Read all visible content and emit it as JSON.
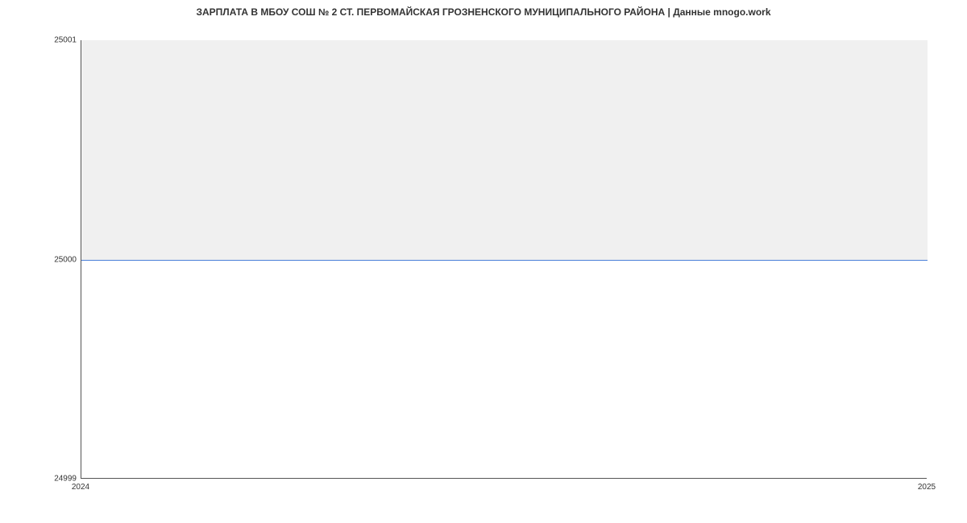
{
  "chart_data": {
    "type": "line",
    "title": "ЗАРПЛАТА В МБОУ СОШ № 2  СТ. ПЕРВОМАЙСКАЯ ГРОЗНЕНСКОГО МУНИЦИПАЛЬНОГО РАЙОНА | Данные mnogo.work",
    "x": [
      2024,
      2025
    ],
    "values": [
      25000,
      25000
    ],
    "xlabel": "",
    "ylabel": "",
    "xlim": [
      2024,
      2025
    ],
    "ylim": [
      24999,
      25001
    ],
    "y_ticks": [
      24999,
      25000,
      25001
    ],
    "x_ticks": [
      2024,
      2025
    ],
    "line_color": "#4a7fd8",
    "fill_color": "#f0f0f0"
  },
  "y_tick_labels": {
    "t0": "24999",
    "t1": "25000",
    "t2": "25001"
  },
  "x_tick_labels": {
    "t0": "2024",
    "t1": "2025"
  }
}
